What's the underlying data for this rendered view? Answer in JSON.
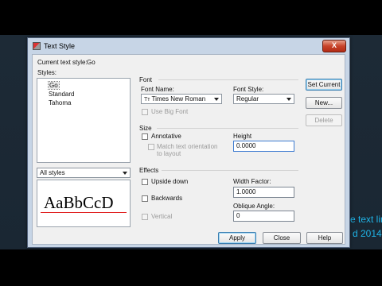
{
  "background": {
    "line1": "e text lin",
    "line2": "d 2014"
  },
  "dialog": {
    "title": "Text Style",
    "close_glyph": "X",
    "current_style_label": "Current text style:",
    "current_style_value": "Go",
    "styles_label": "Styles:",
    "styles": [
      "Go",
      "Standard",
      "Tahoma"
    ],
    "filter_value": "All styles",
    "preview_text": "AaBbCcD",
    "font": {
      "group_label": "Font",
      "font_name_label": "Font Name:",
      "font_name_value": "Times New Roman",
      "font_name_glyph": "Tт",
      "font_style_label": "Font Style:",
      "font_style_value": "Regular",
      "use_big_font_label": "Use Big Font"
    },
    "size": {
      "group_label": "Size",
      "annotative_label": "Annotative",
      "match_orientation_label_1": "Match text orientation",
      "match_orientation_label_2": "to layout",
      "height_label": "Height",
      "height_value": "0.0000"
    },
    "effects": {
      "group_label": "Effects",
      "upside_down_label": "Upside down",
      "backwards_label": "Backwards",
      "vertical_label": "Vertical",
      "width_factor_label": "Width Factor:",
      "width_factor_value": "1.0000",
      "oblique_angle_label": "Oblique Angle:",
      "oblique_angle_value": "0"
    },
    "buttons": {
      "set_current": "Set Current",
      "new": "New...",
      "delete": "Delete",
      "apply": "Apply",
      "close": "Close",
      "help": "Help"
    }
  }
}
